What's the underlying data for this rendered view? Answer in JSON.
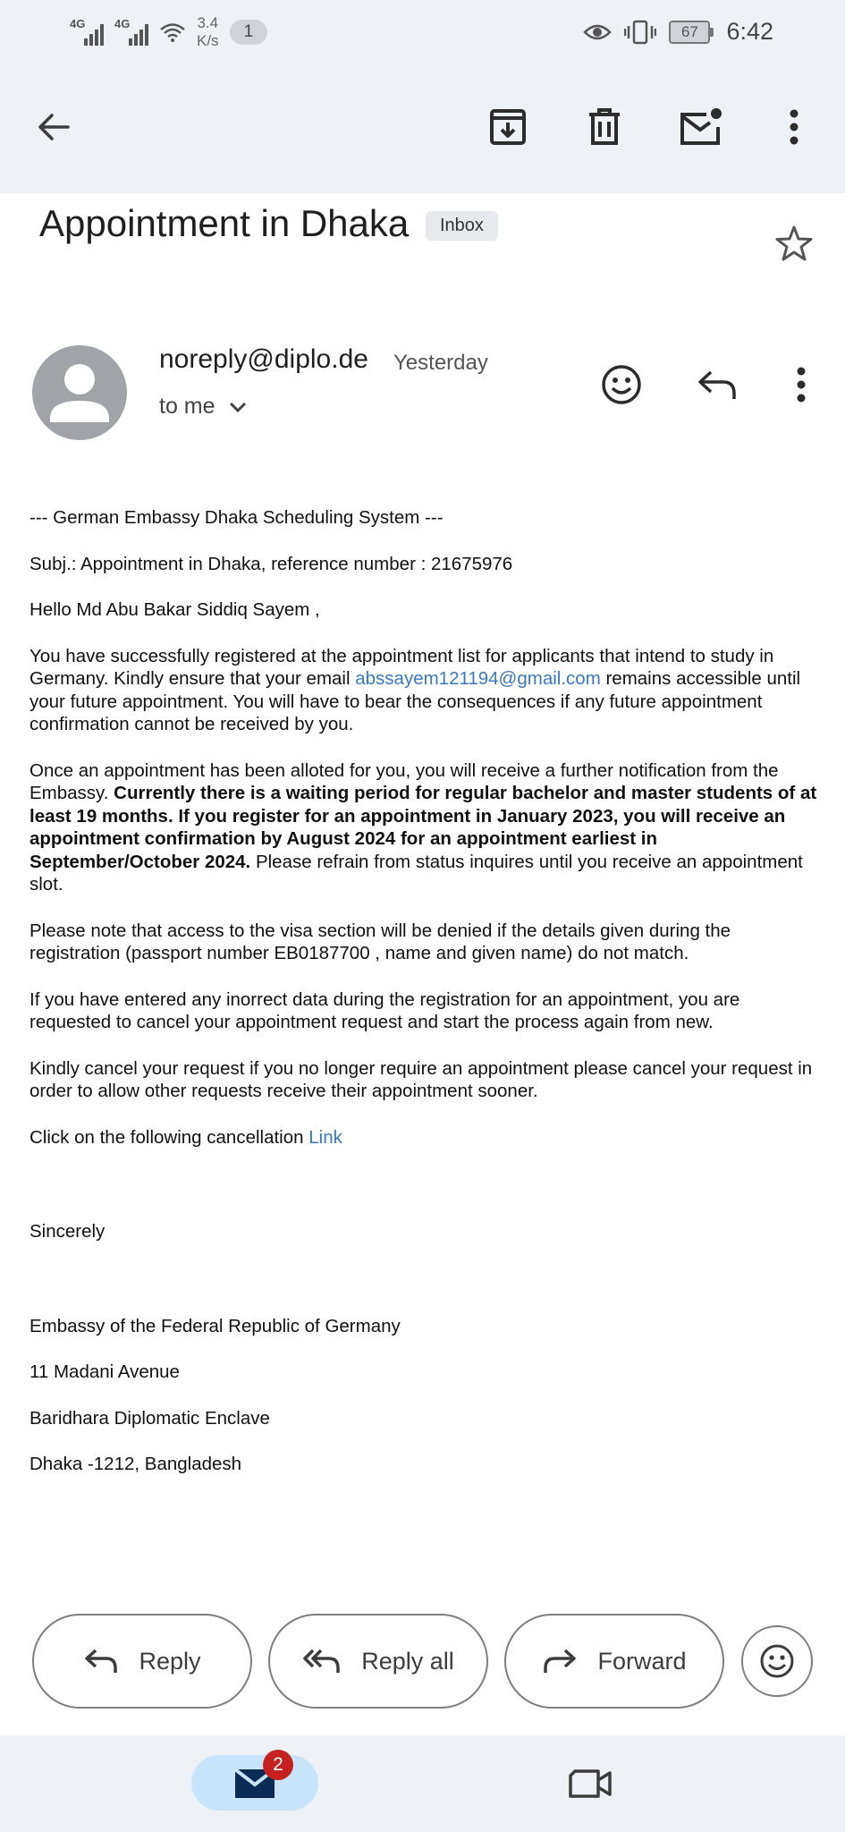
{
  "status_bar": {
    "net1": "4G",
    "net2": "4G",
    "speed_value": "3.4",
    "speed_unit": "K/s",
    "notification_count": "1",
    "battery": "67",
    "time": "6:42"
  },
  "email": {
    "subject": "Appointment in Dhaka",
    "label": "Inbox",
    "sender": "noreply@diplo.de",
    "date": "Yesterday",
    "recipient": "to me",
    "body": {
      "line1": "--- German Embassy Dhaka Scheduling System ---",
      "line2": "Subj.: Appointment in  Dhaka, reference number : 21675976",
      "greeting": "Hello Md Abu Bakar Siddiq Sayem ,",
      "p1_a": "You have successfully registered at the appointment list for applicants that intend to study in Germany. Kindly ensure that your email ",
      "p1_email": "abssayem121194@gmail.com",
      "p1_b": " remains accessible until your future appointment. You will have to bear the consequences if any future appointment confirmation cannot be received by you.",
      "p2_a": "Once an appointment has been alloted for you, you will receive a further notification from the Embassy. ",
      "p2_bold": "Currently there is a waiting period for regular bachelor and master students of at least 19 months. If you register for an appointment in January 2023, you will receive an appointment confirmation by August 2024 for an appointment earliest in September/October 2024.",
      "p2_b": " Please refrain from status inquires until you receive an appointment slot.",
      "p3": "Please note that access to the visa section will be denied if the details given during the registration (passport number EB0187700 , name and given name) do not match.",
      "p4": "If you have entered any inorrect data during the registration for an appointment, you are requested to cancel your appointment request and start the process again from new.",
      "p5": "Kindly cancel your request if you no longer require an appointment please cancel your request in order to allow other requests receive their appointment sooner.",
      "p6_a": "Click on the following cancellation ",
      "p6_link": "Link",
      "closing": "Sincerely",
      "sig1": "Embassy of the Federal Republic of Germany",
      "sig2": "11 Madani Avenue",
      "sig3": "Baridhara Diplomatic Enclave",
      "sig4": "Dhaka -1212, Bangladesh"
    }
  },
  "actions": {
    "reply": "Reply",
    "reply_all": "Reply all",
    "forward": "Forward"
  },
  "bottom_nav": {
    "mail_badge": "2"
  },
  "colors": {
    "link": "#3b78c4",
    "chrome_bg": "#eef1f6",
    "badge": "#c5221f",
    "active_nav": "#c7e4fb"
  }
}
